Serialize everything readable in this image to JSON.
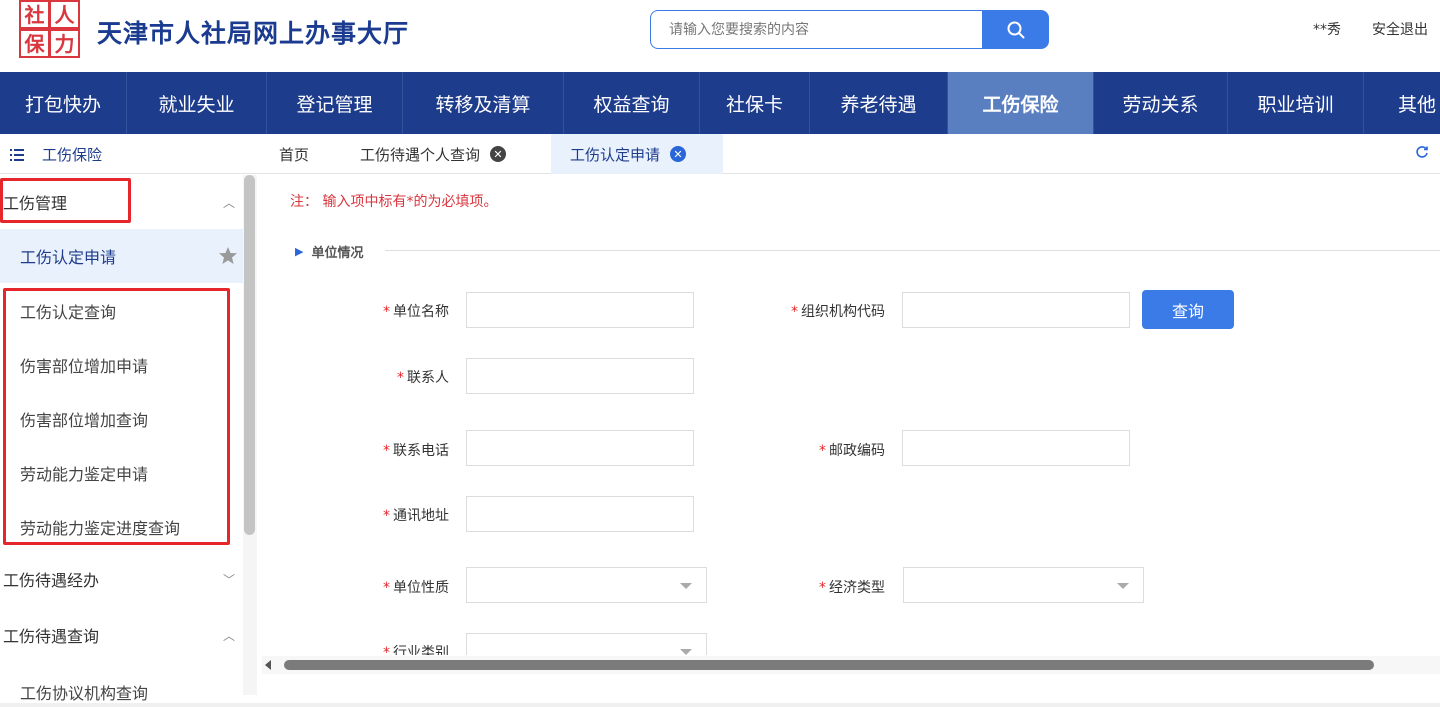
{
  "header": {
    "title": "天津市人社局网上办事大厅",
    "logo_text": [
      "社",
      "人",
      "保",
      "力"
    ],
    "search_placeholder": "请输入您要搜索的内容",
    "user": "**秀",
    "logout": "安全退出"
  },
  "nav": {
    "items": [
      "打包快办",
      "就业失业",
      "登记管理",
      "转移及清算",
      "权益查询",
      "社保卡",
      "养老待遇",
      "工伤保险",
      "劳动关系",
      "职业培训",
      "其他"
    ],
    "active": "工伤保险"
  },
  "tabs": {
    "side_title": "工伤保险",
    "items": [
      {
        "label": "首页"
      },
      {
        "label": "工伤待遇个人查询"
      },
      {
        "label": "工伤认定申请"
      }
    ]
  },
  "sidebar": {
    "items": [
      {
        "label": "工伤管理",
        "type": "group",
        "chevron": "up"
      },
      {
        "label": "工伤认定申请",
        "type": "sub",
        "current": true
      },
      {
        "label": "工伤认定查询",
        "type": "sub"
      },
      {
        "label": "伤害部位增加申请",
        "type": "sub"
      },
      {
        "label": "伤害部位增加查询",
        "type": "sub"
      },
      {
        "label": "劳动能力鉴定申请",
        "type": "sub"
      },
      {
        "label": "劳动能力鉴定进度查询",
        "type": "sub"
      },
      {
        "label": "工伤待遇经办",
        "type": "group",
        "chevron": "down"
      },
      {
        "label": "工伤待遇查询",
        "type": "group",
        "chevron": "up"
      },
      {
        "label": "工伤协议机构查询",
        "type": "sub"
      }
    ]
  },
  "form": {
    "note": "注：  输入项中标有*的为必填项。",
    "section": "单位情况",
    "labels": {
      "unit_name": "单位名称",
      "org_code": "组织机构代码",
      "contact": "联系人",
      "phone": "联系电话",
      "postcode": "邮政编码",
      "address": "通讯地址",
      "unit_nature": "单位性质",
      "econ_type": "经济类型",
      "industry": "行业类别"
    },
    "query_button": "查询"
  },
  "colors": {
    "nav_bg": "#1e3c8c",
    "nav_active": "#5a7fc0",
    "accent": "#3a7be8",
    "required": "#e5262b",
    "highlight_box": "#e5262b"
  }
}
